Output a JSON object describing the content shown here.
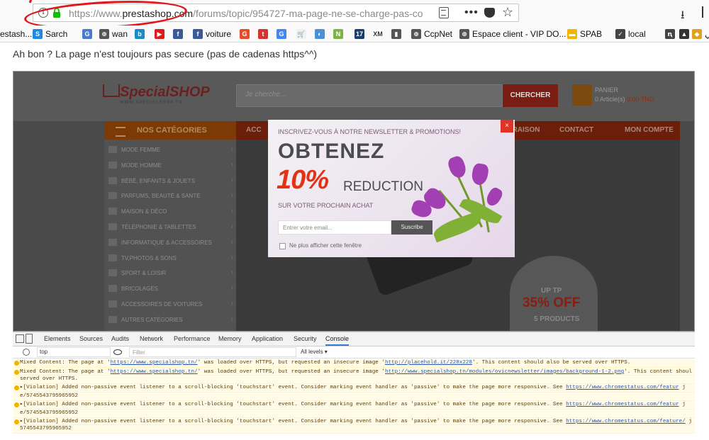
{
  "browser": {
    "url_prefix": "https://www.",
    "url_domain": "prestashop.com",
    "url_path": "/forums/topic/954727-ma-page-ne-se-charge-pas-co",
    "more_dots": "•••",
    "star": "☆",
    "download": "⭳"
  },
  "bookmarks": [
    {
      "label": "estash...",
      "icon": "",
      "color": "#ffffff"
    },
    {
      "label": "Sarch",
      "icon": "S",
      "color": "#1e88e5"
    },
    {
      "label": "",
      "icon": "G",
      "color": "#4a7bd0"
    },
    {
      "label": "wan",
      "icon": "⊕",
      "color": "#555555"
    },
    {
      "label": "",
      "icon": "b",
      "color": "#1c8ac9"
    },
    {
      "label": "",
      "icon": "▶",
      "color": "#e01b1b"
    },
    {
      "label": "",
      "icon": "f",
      "color": "#3b5998"
    },
    {
      "label": "voiture",
      "icon": "f",
      "color": "#3b5998"
    },
    {
      "label": "",
      "icon": "G",
      "color": "#e54d26"
    },
    {
      "label": "",
      "icon": "t",
      "color": "#d4342d"
    },
    {
      "label": "",
      "icon": "G",
      "color": "#4285f4"
    },
    {
      "label": "",
      "icon": "🛒",
      "color": "#f0f0f0"
    },
    {
      "label": "",
      "icon": "◐",
      "color": "#4a90d9"
    },
    {
      "label": "",
      "icon": "N",
      "color": "#7cb342"
    },
    {
      "label": "",
      "icon": "17",
      "color": "#1a3c6e"
    },
    {
      "label": "",
      "icon": "XM",
      "color": "#ffffff"
    },
    {
      "label": "",
      "icon": "▮",
      "color": "#555555"
    },
    {
      "label": "CcpNet",
      "icon": "⊕",
      "color": "#555555"
    },
    {
      "label": "Espace client - VIP DO...",
      "icon": "⊕",
      "color": "#555555"
    },
    {
      "label": "SPAB",
      "icon": "▬",
      "color": "#f2b600"
    },
    {
      "label": "local",
      "icon": "✓",
      "color": "#444444"
    },
    {
      "label": "",
      "icon": "ꞑ",
      "color": "#444444"
    },
    {
      "label": "",
      "icon": "▲",
      "color": "#333333"
    },
    {
      "label": "مي",
      "icon": "◆",
      "color": "#e0a020"
    }
  ],
  "post": {
    "text": "Ah bon ? La page n'est toujours pas secure (pas de cadenas https^^)"
  },
  "shop": {
    "logo": "SpecialSHOP",
    "logo_sub": "WWW.SPECIALSHOP.TN",
    "search_placeholder": "Je cherche...",
    "search_button": "CHERCHER",
    "cart_title": "PANIER",
    "cart_items": "0 Article(s)",
    "cart_amount": "0.00 TND",
    "cat_header": "NOS CATÉGORIES",
    "nav": [
      "ACC",
      "LIVRAISON",
      "CONTACT",
      "MON COMPTE"
    ],
    "categories": [
      "MODE FEMME",
      "MODE HOMME",
      "BÉBÉ, ENFANTS & JOUETS",
      "PARFUMS, BEAUTÉ & SANTÉ",
      "MAISON & DÉCO",
      "TÉLÉPHONIE & TABLETTES",
      "INFORMATIQUE & ACCESSOIRES",
      "TV,PHOTOS & SONS",
      "SPORT & LOISIR",
      "BRICOLAGES",
      "ACCESSOIRES DE VOITURES",
      "AUTRES CATÉGORIES"
    ],
    "promo_top": "UP TP",
    "promo_pct": "35% OFF",
    "promo_products": "5 PRODUCTS"
  },
  "popup": {
    "header": "INSCRIVEZ-VOUS À NOTRE NEWSLETTER & PROMOTIONS!",
    "close": "×",
    "obtenez": "OBTENEZ",
    "pct": "10%",
    "reduction": "REDUCTION",
    "subtitle": "SUR VOTRE PROCHAIN ACHAT",
    "email_placeholder": "Entrer votre email...",
    "subscribe": "Suscribe",
    "checkbox_label": "Ne plus afficher cette fenêtre"
  },
  "devtools": {
    "tabs": [
      "Elements",
      "Sources",
      "Audits",
      "Network",
      "Performance",
      "Memory",
      "Application",
      "Security",
      "Console"
    ],
    "active_tab": "Console",
    "context": "top",
    "filter_placeholder": "Filter",
    "levels": "All levels ▾",
    "logs": [
      {
        "pre": "Mixed Content: The page at '",
        "link1": "https://www.specialshop.tn/",
        "mid": "' was loaded over HTTPS, but requested an insecure image '",
        "link2": "http://placehold.it/228x228",
        "post": "'. This content should also be served over HTTPS."
      },
      {
        "pre": "Mixed Content: The page at '",
        "link1": "https://www.specialshop.tn/",
        "mid": "' was loaded over HTTPS, but requested an insecure image '",
        "link2": "http://www.specialshop.tn/modules/ovicnewsletter/images/background-1-2.png",
        "post": "'. This content shoul"
      },
      {
        "pre": "served over HTTPS.",
        "link1": "",
        "mid": "",
        "link2": "",
        "post": ""
      },
      {
        "pre": "▸[Violation] Added non-passive event listener to a scroll-blocking 'touchstart' event. Consider marking event handler as 'passive' to make the page more responsive. See ",
        "link1": "https://www.chromestatus.com/featur",
        "mid": "",
        "link2": "",
        "post": " j"
      },
      {
        "pre": "e/5745543795965952",
        "link1": "",
        "mid": "",
        "link2": "",
        "post": ""
      },
      {
        "pre": "▸[Violation] Added non-passive event listener to a scroll-blocking 'touchstart' event. Consider marking event handler as 'passive' to make the page more responsive. See ",
        "link1": "https://www.chromestatus.com/featur",
        "mid": "",
        "link2": "",
        "post": " j"
      },
      {
        "pre": "e/5745543795965952",
        "link1": "",
        "mid": "",
        "link2": "",
        "post": ""
      },
      {
        "pre": "▸[Violation] Added non-passive event listener to a scroll-blocking 'touchstart' event. Consider marking event handler as 'passive' to make the page more responsive. See ",
        "link1": "https://www.chromestatus.com/feature/",
        "mid": "",
        "link2": "",
        "post": " j"
      },
      {
        "pre": "5745543795965952",
        "link1": "",
        "mid": "",
        "link2": "",
        "post": ""
      }
    ]
  }
}
